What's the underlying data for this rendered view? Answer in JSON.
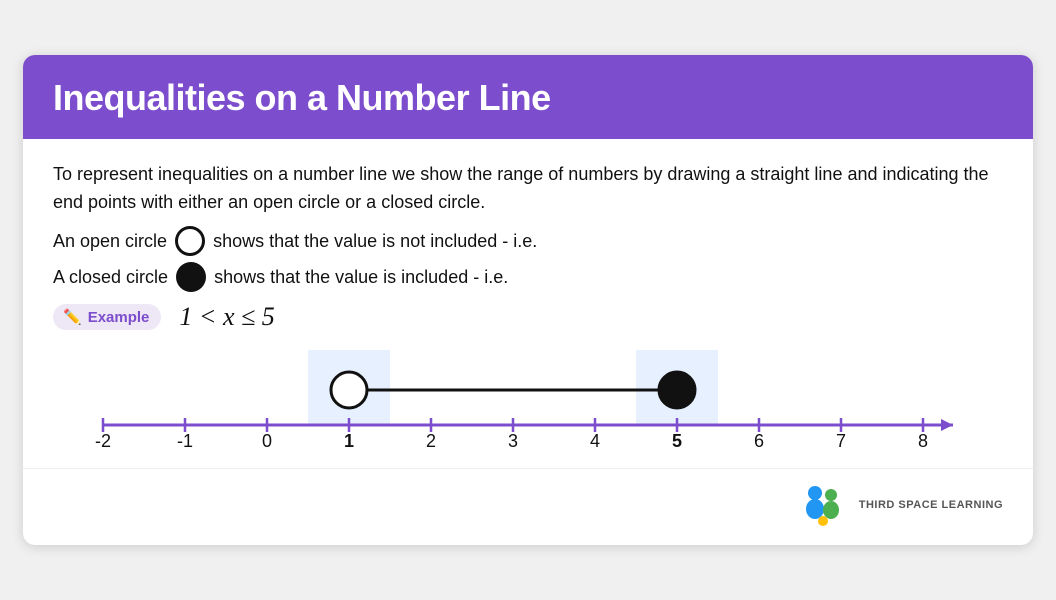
{
  "header": {
    "title": "Inequalities on a Number Line"
  },
  "content": {
    "description": "To represent inequalities on a number line we show the range of numbers by drawing a straight line and indicating the end points with either an open circle or a closed circle.",
    "open_circle_line": {
      "prefix": "An open circle",
      "suffix": "shows that the value is not included - i.e."
    },
    "closed_circle_line": {
      "prefix": "A closed circle",
      "suffix": "shows that the value is included - i.e."
    },
    "example_badge": "Example",
    "inequality": "1 < x ≤ 5",
    "inequality_math": "1 < x ≤ 5"
  },
  "number_line": {
    "min": -2,
    "max": 8,
    "open_point": 1,
    "closed_point": 5,
    "labels": [
      -2,
      -1,
      0,
      1,
      2,
      3,
      4,
      5,
      6,
      7,
      8
    ]
  },
  "branding": {
    "name": "THIRD SPACE LEARNING"
  },
  "icons": {
    "pencil": "✏️",
    "open_circle": "open-circle",
    "closed_circle": "closed-circle"
  }
}
